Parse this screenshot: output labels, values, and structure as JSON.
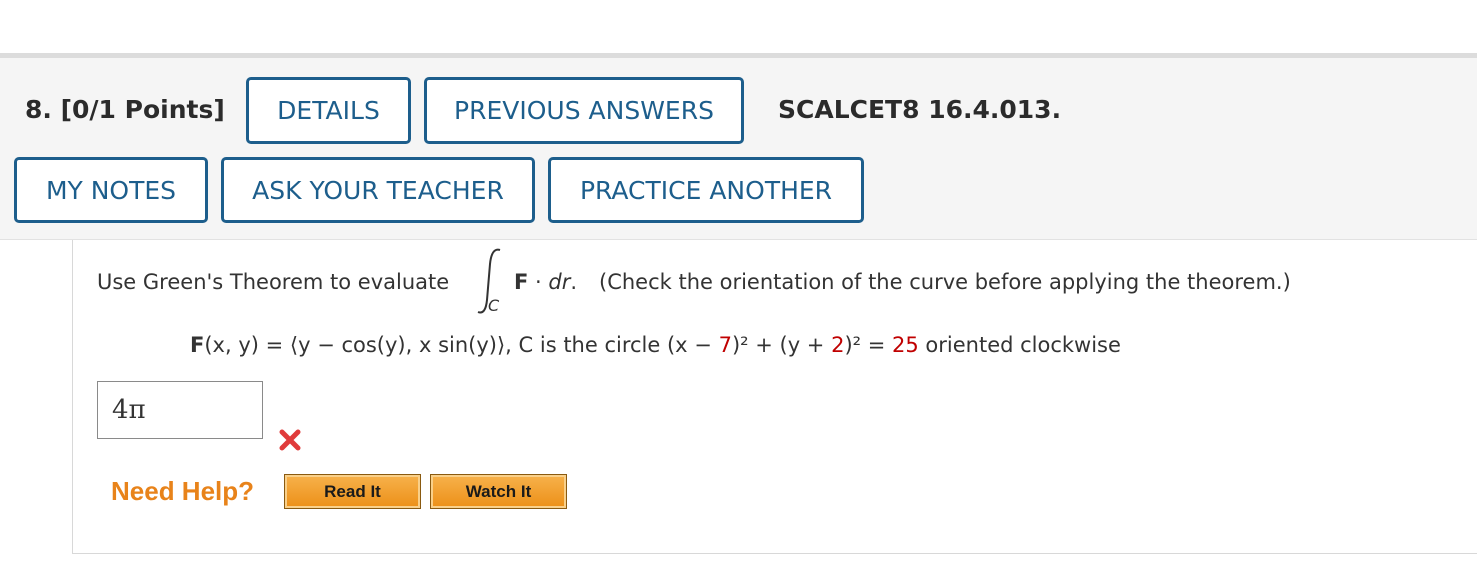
{
  "question": {
    "label": "8. [0/1 Points]",
    "code": "SCALCET8 16.4.013."
  },
  "buttons": {
    "details": "DETAILS",
    "previous_answers": "PREVIOUS ANSWERS",
    "my_notes": "MY NOTES",
    "ask_teacher": "ASK YOUR TEACHER",
    "practice_another": "PRACTICE ANOTHER"
  },
  "problem": {
    "intro": "Use Green's Theorem to evaluate",
    "integrand_F": "F",
    "integrand_dot": " · ",
    "integrand_dr": "dr",
    "integrand_period": ".",
    "contour_label": "C",
    "note": "(Check the orientation of the curve before applying the theorem.)",
    "field_prefix_bold": "F",
    "field_rest": "(x, y) = ⟨y − cos(y), x sin(y)⟩,",
    "curve_text": "C is the circle (x − ",
    "h": "7",
    "curve_mid": ")² + (y + ",
    "k": "2",
    "curve_after": ")² = ",
    "r2": "25",
    "orientation": " oriented clockwise"
  },
  "answer": {
    "value": "4π",
    "status": "incorrect"
  },
  "help": {
    "label": "Need Help?",
    "read_it": "Read It",
    "watch_it": "Watch It"
  },
  "colors": {
    "button_border": "#1d5e8c",
    "highlight_red": "#c00000",
    "help_orange": "#e8831a",
    "error_x": "#e03a3a"
  }
}
